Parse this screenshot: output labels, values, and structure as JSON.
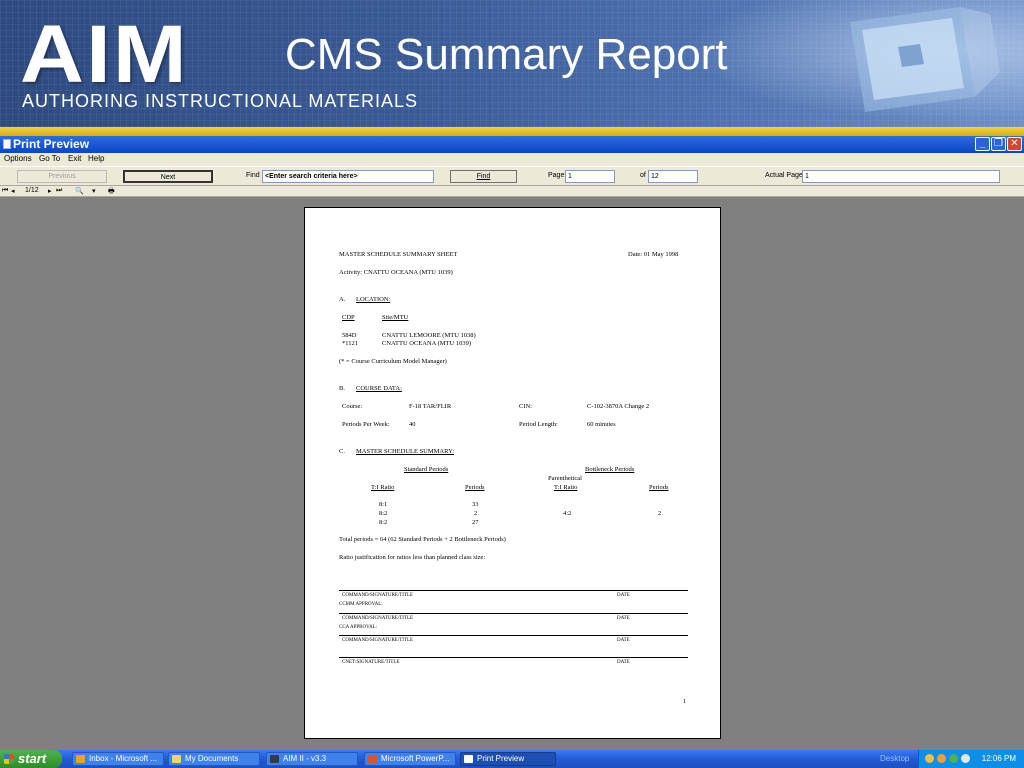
{
  "banner": {
    "logo": "AIM",
    "tagline": "AUTHORING INSTRUCTIONAL MATERIALS",
    "title": "CMS Summary Report"
  },
  "window": {
    "title": "Print Preview",
    "menu": [
      "Options",
      "Go To",
      "Exit",
      "Help"
    ],
    "toolbar": {
      "previous": "Previous",
      "next": "Next",
      "find_label": "Find",
      "find_value": "<Enter search criteria here>",
      "find_button": "Find",
      "page_label": "Page",
      "page_value": "1",
      "of_label": "of",
      "of_value": "12",
      "actual_page_label": "Actual Page",
      "actual_page_value": "1"
    },
    "nav": {
      "page_counter": "1/12"
    }
  },
  "report": {
    "heading": "MASTER SCHEDULE SUMMARY SHEET",
    "date": "Date: 01 May 1998",
    "activity": "Activity:  CNATTU OCEANA (MTU 1039)",
    "section_a_letter": "A.",
    "section_a": "LOCATION:",
    "loc_col1": "CDP",
    "loc_col2": "Site/MTU",
    "loc_rows": [
      {
        "cdp": "584D",
        "site": "CNATTU LEMOORE (MTU 1038)"
      },
      {
        "cdp": "*1121",
        "site": "CNATTU OCEANA (MTU 1039)"
      }
    ],
    "loc_note": "(* = Course Curriculum Model Manager)",
    "section_b_letter": "B.",
    "section_b": "COURSE DATA:",
    "course_label": "Course:",
    "course_value": "F-18 TAR/FLIR",
    "cin_label": "CIN:",
    "cin_value": "C-102-3870A Change 2",
    "ppw_label": "Periods Per Week:",
    "ppw_value": "40",
    "pl_label": "Period Length:",
    "pl_value": "60 minutes",
    "section_c_letter": "C.",
    "section_c": "MASTER SCHEDULE SUMMARY:",
    "standard_periods": "Standard Periods",
    "bottleneck_periods": "Bottleneck Periods",
    "parenthetical": "Parenthetical",
    "ti_ratio": "T:I Ratio",
    "periods": "Periods",
    "standard_rows": [
      {
        "ratio": "8:1",
        "periods": "33"
      },
      {
        "ratio": "8:2",
        "periods": "2"
      },
      {
        "ratio": "8:2",
        "periods": "27"
      }
    ],
    "bottleneck_rows": [
      {
        "ratio": "4:2",
        "periods": "2"
      }
    ],
    "total": "Total periods = 64 (62 Standard Periods + 2 Bottleneck Periods)",
    "justification": "Ratio justification for ratios less than planned class size:",
    "sig1_label": "COMMAND/SIGNATURE/TITLE",
    "sig1_date": "DATE",
    "ccmm_approval": "CCMM APPROVAL:",
    "sig2_label": "COMMAND/SIGNATURE/TITLE",
    "sig2_date": "DATE",
    "cca_approval": "CCA APPROVAL:",
    "sig3_label": "COMMAND/SIGNATURE/TITLE",
    "sig3_date": "DATE",
    "sig4_label": "CNET/SIGNATURE/TITLE",
    "sig4_date": "DATE",
    "page_number": "1"
  },
  "taskbar": {
    "start": "start",
    "tasks": [
      "Inbox - Microsoft ...",
      "My Documents",
      "AIM II - v3.3",
      "Microsoft PowerP...",
      "Print Preview"
    ],
    "desktop": "Desktop",
    "clock": "12:06 PM"
  },
  "colors": {
    "titlebar": "#0a46c8",
    "banner_gold": "#d9ad10",
    "window_bg": "#808080",
    "chrome": "#ece9d8"
  }
}
